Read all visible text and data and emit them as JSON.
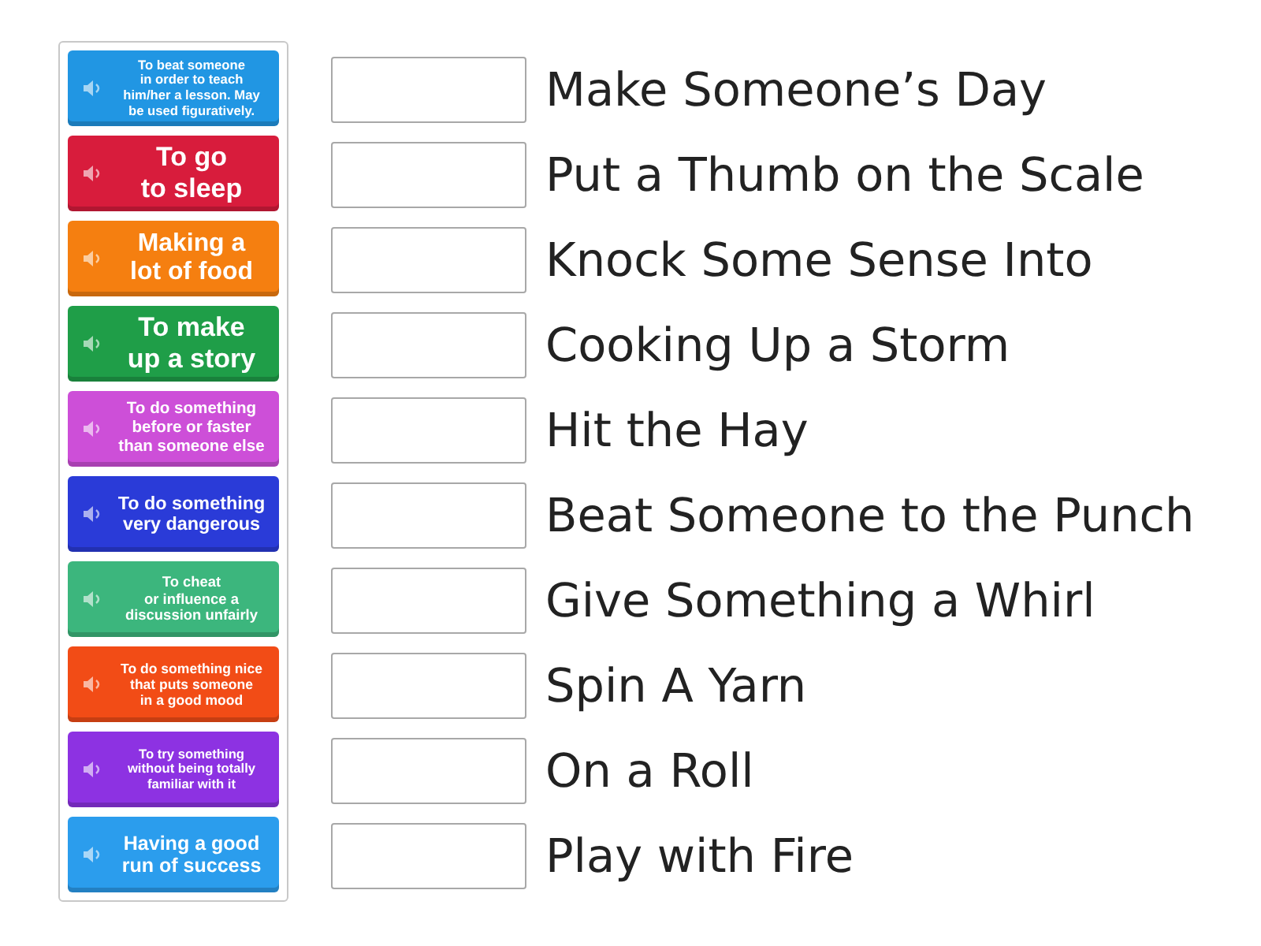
{
  "cards": [
    {
      "text": "To beat someone\nin order to teach\nhim/her a lesson. May\nbe used figuratively.",
      "color": "#2196e3"
    },
    {
      "text": "To go\nto sleep",
      "color": "#d81c3c"
    },
    {
      "text": "Making a\nlot of food",
      "color": "#f57f10"
    },
    {
      "text": "To make\nup a story",
      "color": "#1f9e48"
    },
    {
      "text": "To do something\nbefore or faster\nthan someone else",
      "color": "#cd4fd8"
    },
    {
      "text": "To do something\nvery dangerous",
      "color": "#2a3bd8"
    },
    {
      "text": "To cheat\nor influence a\ndiscussion unfairly",
      "color": "#3cb67d"
    },
    {
      "text": "To do something nice\nthat puts someone\nin a good mood",
      "color": "#f24c16"
    },
    {
      "text": "To try something\nwithout being totally\nfamiliar with it",
      "color": "#8d32e2"
    },
    {
      "text": "Having a good\nrun of success",
      "color": "#2b9ded"
    }
  ],
  "matches": [
    {
      "phrase": "Make Someone’s Day"
    },
    {
      "phrase": "Put a Thumb on the Scale"
    },
    {
      "phrase": "Knock Some Sense Into"
    },
    {
      "phrase": "Cooking Up a Storm"
    },
    {
      "phrase": "Hit the Hay"
    },
    {
      "phrase": "Beat Someone to the Punch"
    },
    {
      "phrase": "Give Something a Whirl"
    },
    {
      "phrase": "Spin A Yarn"
    },
    {
      "phrase": "On a Roll"
    },
    {
      "phrase": "Play with Fire"
    }
  ]
}
